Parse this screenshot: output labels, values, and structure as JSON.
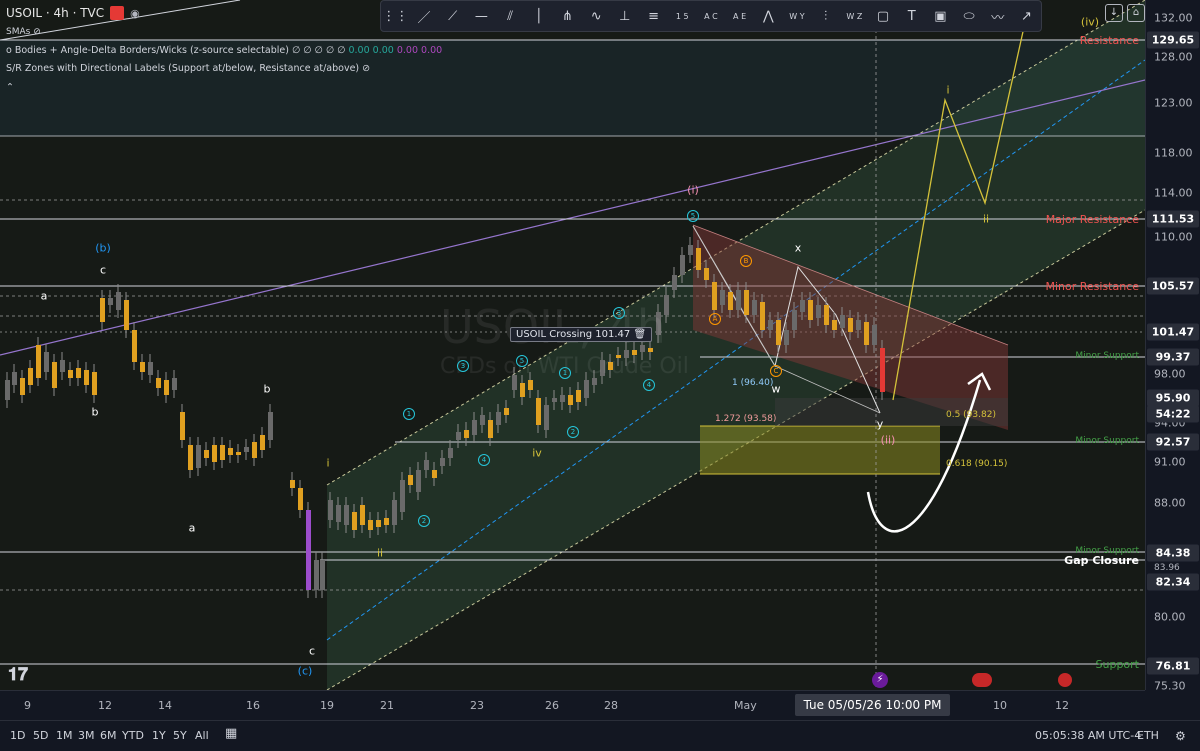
{
  "header": {
    "symbol_title": "USOIL · 4h · TVC",
    "indicator_1": "o Bodies + Angle-Delta Borders/Wicks (z-source selectable)",
    "indicator_1_values": "∅ ∅ ∅ ∅ ∅",
    "indicator_1_nums": [
      "0.00",
      "0.00",
      "0.00",
      "0.00"
    ],
    "indicator_2": "S/R Zones with Directional Labels (Support at/below, Resistance at/above)",
    "smas_label": "SMAs",
    "collapse_icon": "chevron-up-icon"
  },
  "watermark": {
    "symbol": "USOIL, 4h",
    "name": "CFDs on WTI Crude Oil"
  },
  "toolbar": {
    "tools": [
      "cursor-lines",
      "ray",
      "trend-angle",
      "horizontal",
      "channel",
      "vertical",
      "pitchfork",
      "path",
      "info-line",
      "parallel",
      "pattern-15",
      "pattern-abc",
      "pattern-ae",
      "cycle",
      "pattern-wy",
      "chart-bars",
      "pattern-wz",
      "rectangle",
      "text",
      "price-note",
      "ellipse",
      "curve",
      "arrow"
    ],
    "labels": {
      "p15": "1 5",
      "pabc": "A C",
      "pae": "A E",
      "pwy": "W Y",
      "pwz": "W Z",
      "text": "T",
      "dollar": "$"
    }
  },
  "price_axis": {
    "ticks": [
      "132.00",
      "128.00",
      "123.00",
      "118.00",
      "114.00",
      "110.00",
      "98.00",
      "94.00",
      "91.00",
      "88.00",
      "80.00",
      "75.30"
    ],
    "labels": [
      {
        "value": "129.65",
        "color": "#2a2e39"
      },
      {
        "value": "111.53",
        "color": "#2a2e39"
      },
      {
        "value": "105.57",
        "color": "#2a2e39"
      },
      {
        "value": "101.47",
        "color": "#2a2e39"
      },
      {
        "value": "99.37",
        "color": "#2a2e39"
      },
      {
        "value": "95.90",
        "color": "#2a2e39"
      },
      {
        "value": "54:22",
        "color": "#2a2e39"
      },
      {
        "value": "92.57",
        "color": "#2a2e39"
      },
      {
        "value": "84.38",
        "color": "#2a2e39"
      },
      {
        "value": "82.34",
        "color": "#2a2e39"
      },
      {
        "value": "76.81",
        "color": "#2a2e39"
      }
    ],
    "partial_labels": [
      "83.96"
    ]
  },
  "zones": {
    "resistance": "Resistance",
    "major_resistance": "Major Resistance",
    "minor_resistance": "Minor Resistance",
    "minor_support_1": "Minor Support",
    "minor_support_2": "Minor Support",
    "minor_support_3": "Minor Support",
    "gap_closure": "Gap Closure",
    "support": "Support"
  },
  "waves": {
    "b_blue": "(b)",
    "c_top": "c",
    "a_left": "a",
    "b_left": "b",
    "b_mid": "b",
    "a_mid": "a",
    "c_low": "c",
    "c_blue": "(c)",
    "i_low": "i",
    "ii_low": "ii",
    "iv_mid": "iv",
    "i_paren": "(i)",
    "x": "x",
    "w": "w",
    "y": "y",
    "ii_paren": "(ii)",
    "i_proj": "i",
    "ii_proj": "ii",
    "iv_paren": "(iv)",
    "circled": [
      "1",
      "2",
      "3",
      "4",
      "5",
      "1",
      "2",
      "3",
      "4",
      "5",
      "5"
    ],
    "A": "A",
    "B": "B",
    "C": "C"
  },
  "fib": {
    "f1": "1 (96.40)",
    "f1272": "1.272 (93.58)",
    "f05": "0.5 (93.82)",
    "f0618": "0.618 (90.15)"
  },
  "crossing_label": "USOIL Crossing 101.47",
  "time_axis": {
    "ticks": [
      "9",
      "12",
      "14",
      "16",
      "19",
      "21",
      "23",
      "26",
      "28",
      "May",
      "10",
      "12"
    ],
    "cursor": "Tue 05/05/26   10:00 PM"
  },
  "bottom_bar": {
    "ranges": [
      "1D",
      "5D",
      "1M",
      "3M",
      "6M",
      "YTD",
      "1Y",
      "5Y",
      "All"
    ],
    "clock": "05:05:38 AM UTC-4",
    "session": "ETH"
  },
  "colors": {
    "accent_red": "#e53935",
    "zone_red": "#ef5350",
    "zone_green": "#43a047",
    "channel_green": "#2e4d3a",
    "projection_yellow": "#d4c23a",
    "trendline_purple": "#9575cd"
  }
}
